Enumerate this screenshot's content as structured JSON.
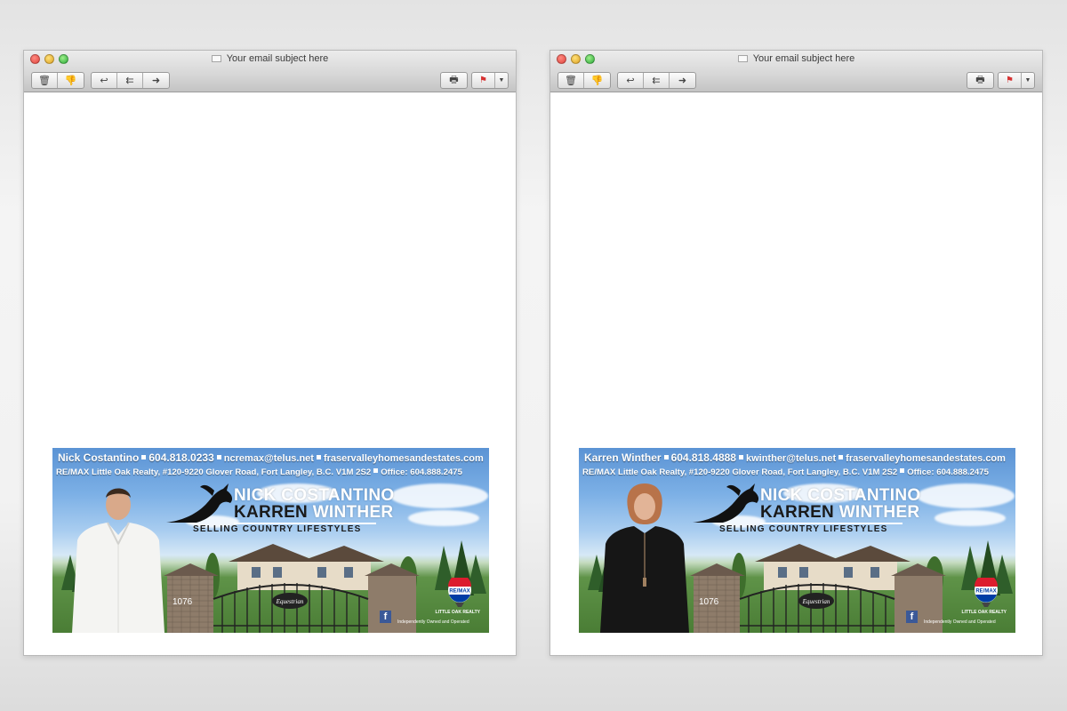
{
  "windows": [
    {
      "id": "left",
      "subject": "Your email subject here",
      "banner": {
        "contact_name": "Nick Costantino",
        "phone": "604.818.0233",
        "email": "ncremax@telus.net",
        "website": "fraservalleyhomesandestates.com",
        "address": "RE/MAX Little Oak Realty, #120-9220 Glover Road, Fort Langley, B.C. V1M 2S2",
        "office": "Office: 604.888.2475",
        "name1_first": "NICK",
        "name1_last": "COSTANTINO",
        "name2_first": "KARREN",
        "name2_last": "WINTHER",
        "tagline": "SELLING COUNTRY LIFESTYLES",
        "brand": "RE/MAX",
        "brokerage": "LITTLE OAK REALTY",
        "disclaimer": "Independently Owned and Operated",
        "sign_text": "Equestrian",
        "house_number": "1076",
        "person": "male-agent"
      }
    },
    {
      "id": "right",
      "subject": "Your email subject here",
      "banner": {
        "contact_name": "Karren Winther",
        "phone": "604.818.4888",
        "email": "kwinther@telus.net",
        "website": "fraservalleyhomesandestates.com",
        "address": "RE/MAX Little Oak Realty, #120-9220 Glover Road, Fort Langley, B.C. V1M 2S2",
        "office": "Office: 604.888.2475",
        "name1_first": "NICK",
        "name1_last": "COSTANTINO",
        "name2_first": "KARREN",
        "name2_last": "WINTHER",
        "tagline": "SELLING COUNTRY LIFESTYLES",
        "brand": "RE/MAX",
        "brokerage": "LITTLE OAK REALTY",
        "disclaimer": "Independently Owned and Operated",
        "sign_text": "Equestrian",
        "house_number": "1076",
        "person": "female-agent"
      }
    }
  ],
  "icons": [
    "trash-icon",
    "junk-icon",
    "reply-icon",
    "reply-all-icon",
    "forward-icon",
    "print-icon",
    "flag-icon",
    "chevron-down-icon",
    "envelope-icon"
  ],
  "colors": {
    "sky": "#7cb0e6",
    "grass": "#4a7d35",
    "facebook": "#3b5998",
    "remax_red": "#dc1c2e",
    "remax_blue": "#003da5"
  }
}
